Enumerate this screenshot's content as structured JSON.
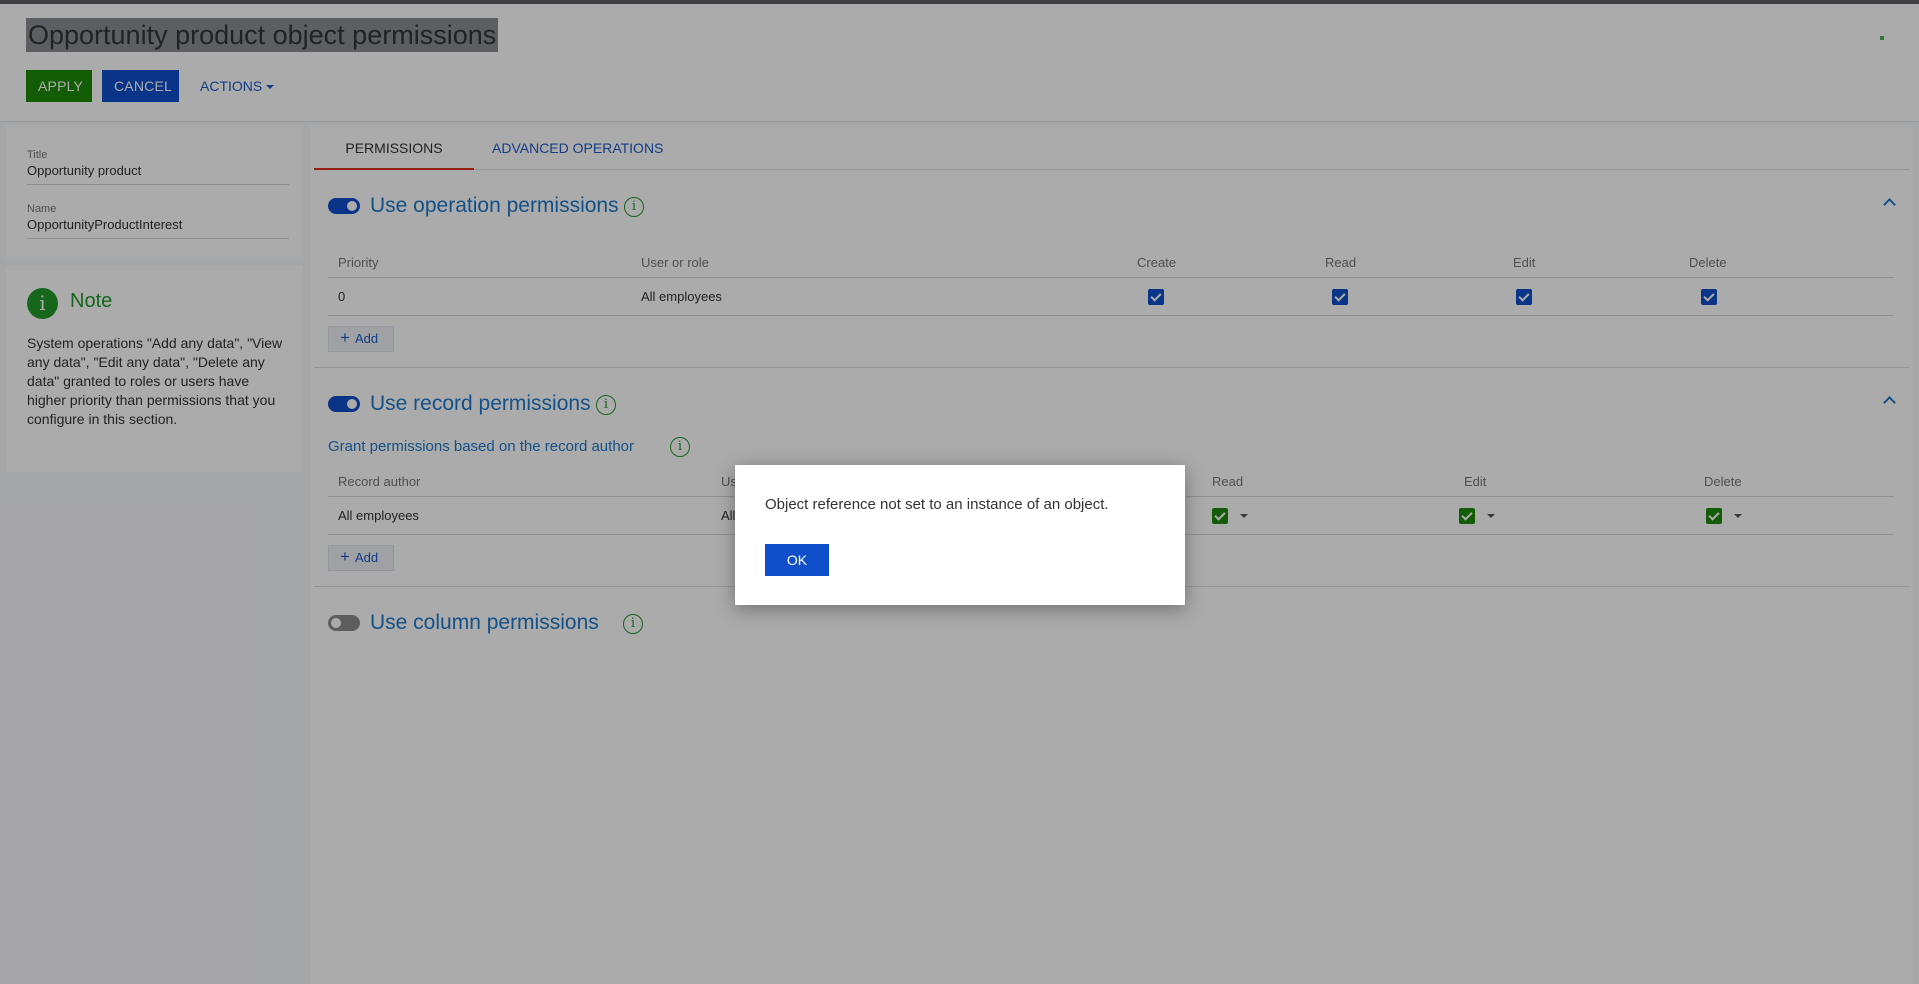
{
  "header": {
    "title": "Opportunity product object permissions",
    "apply_label": "APPLY",
    "cancel_label": "CANCEL",
    "actions_label": "ACTIONS"
  },
  "details": {
    "title_label": "Title",
    "title_value": "Opportunity product",
    "name_label": "Name",
    "name_value": "OpportunityProductInterest"
  },
  "note": {
    "icon": "i",
    "title": "Note",
    "text": "System operations \"Add any data\", \"View any data\", \"Edit any data\", \"Delete any data\" granted to roles or users have higher priority than permissions that you configure in this section."
  },
  "tabs": [
    {
      "label": "PERMISSIONS",
      "active": true
    },
    {
      "label": "ADVANCED OPERATIONS",
      "active": false
    }
  ],
  "operation_permissions": {
    "title": "Use operation permissions",
    "enabled": true,
    "columns": [
      "Priority",
      "User or role",
      "Create",
      "Read",
      "Edit",
      "Delete"
    ],
    "rows": [
      {
        "priority": "0",
        "user": "All employees",
        "create": true,
        "read": true,
        "edit": true,
        "delete": true
      }
    ],
    "add_label": "Add"
  },
  "record_permissions": {
    "title": "Use record permissions",
    "enabled": true,
    "subtitle": "Grant permissions based on the record author",
    "columns": [
      "Record author",
      "Us",
      "Read",
      "Edit",
      "Delete"
    ],
    "rows": [
      {
        "author": "All employees",
        "user": "All",
        "read": true,
        "edit": true,
        "delete": true
      }
    ],
    "add_label": "Add"
  },
  "column_permissions": {
    "title": "Use column permissions",
    "enabled": false
  },
  "info_glyph": "i",
  "dialog": {
    "message": "Object reference not set to an instance of an object.",
    "ok_label": "OK"
  },
  "colors": {
    "apply": "#1d8a0a",
    "primary": "#0f4ec9",
    "link": "#1f7acb",
    "info_green": "#219a2b",
    "active_tab": "#e0301e"
  }
}
